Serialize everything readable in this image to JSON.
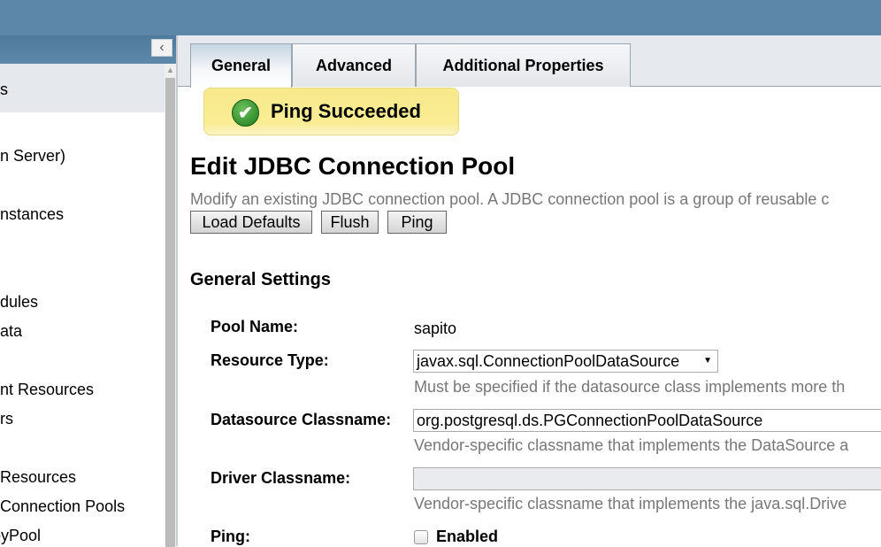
{
  "sidebar": {
    "collapse_icon": "chevron-left-icon",
    "items": [
      "s",
      "n Server)",
      "nstances",
      "dules",
      "ata",
      "nt Resources",
      "rs",
      "Resources",
      "Connection Pools",
      "oyPool"
    ]
  },
  "tabs": [
    {
      "label": "General",
      "active": true
    },
    {
      "label": "Advanced"
    },
    {
      "label": "Additional Properties"
    }
  ],
  "alert": {
    "text": "Ping Succeeded",
    "icon": "check-circle-icon"
  },
  "page": {
    "title": "Edit JDBC Connection Pool",
    "description": "Modify an existing JDBC connection pool. A JDBC connection pool is a group of reusable c",
    "buttons": {
      "load_defaults": "Load Defaults",
      "flush": "Flush",
      "ping": "Ping"
    },
    "section_title": "General Settings",
    "fields": {
      "pool_name": {
        "label": "Pool Name:",
        "value": "sapito"
      },
      "resource_type": {
        "label": "Resource Type:",
        "value": "javax.sql.ConnectionPoolDataSource",
        "help": "Must be specified if the datasource class implements more th"
      },
      "datasource_classname": {
        "label": "Datasource Classname:",
        "value": "org.postgresql.ds.PGConnectionPoolDataSource",
        "help": "Vendor-specific classname that implements the DataSource a"
      },
      "driver_classname": {
        "label": "Driver Classname:",
        "value": "",
        "help": "Vendor-specific classname that implements the java.sql.Drive"
      },
      "ping": {
        "label": "Ping:",
        "checkbox_label": "Enabled",
        "checked": false
      }
    }
  },
  "colors": {
    "header": "#5c87a8",
    "alert_bg": "#f8e98a",
    "success": "#2e8b2e"
  }
}
